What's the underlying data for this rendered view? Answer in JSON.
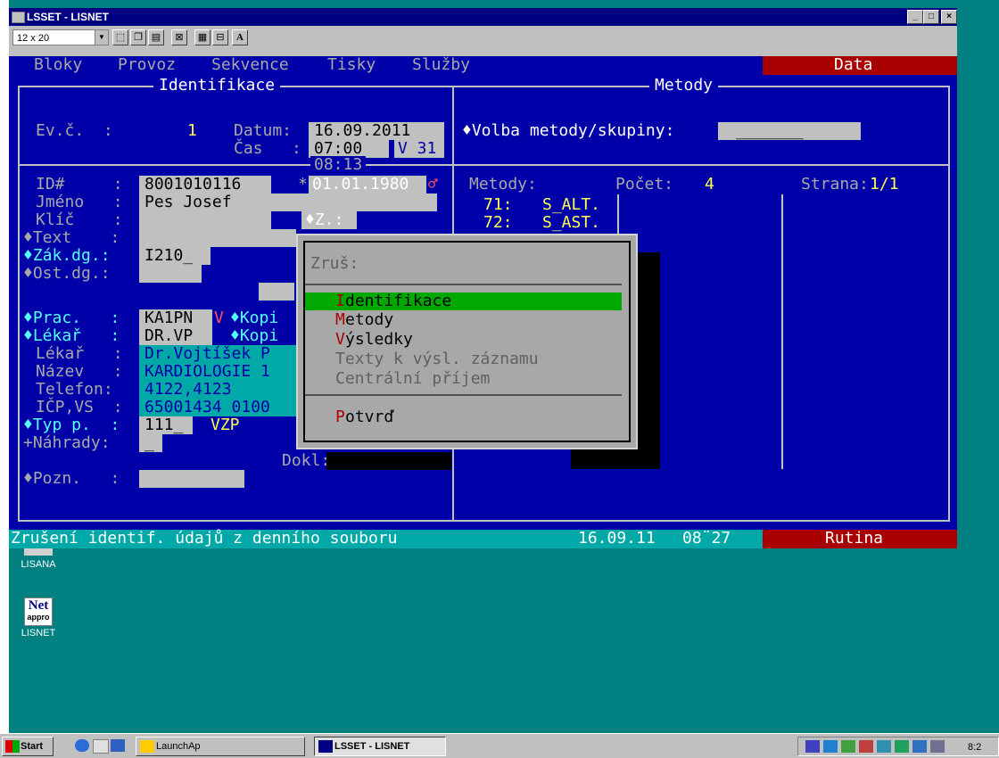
{
  "window": {
    "title": "LSSET - LISNET",
    "min": "_",
    "max": "□",
    "close": "×"
  },
  "toolbar": {
    "font_size": "12 x 20",
    "font_button": "A"
  },
  "menu": {
    "items": [
      "Bloky",
      "Provoz",
      "Sekvence",
      "Tisky",
      "Služby"
    ],
    "mode": "Data"
  },
  "identifikace": {
    "title": "Identifikace",
    "evc_label": "Ev.č.  :",
    "evc_value": "1",
    "datum_label": "Datum:",
    "datum_value": "16.09.2011",
    "cas_label": "Čas   :",
    "cas_value": "07:00",
    "v_value": "V 31",
    "time_below": "08:13",
    "id_label": "ID#     :",
    "id_value": "8001010116",
    "birth_marker": "*",
    "birth_date": "01.01.1980",
    "sex": "♂",
    "jmeno_label": "Jméno   :",
    "jmeno_value": "Pes Josef",
    "klic_label": "Klíč    :",
    "z_label": "♦Z.:",
    "text_label": "♦Text    :",
    "zakdg_label": "♦Zák.dg.:",
    "zakdg_value": "I210_",
    "ostdg_label": "♦Ost.dg.:",
    "prac_label": "♦Prac.   :",
    "prac_value": "KA1PN",
    "prac_flag": "V",
    "kopie1": "♦Kopi",
    "lekar1_label": "♦Lékař   :",
    "lekar1_value": "DR.VP",
    "kopie2": "♦Kopi",
    "lekar2_label": "Lékař   :",
    "lekar2_value": "Dr.Vojtíšek P",
    "nazev_label": "Název   :",
    "nazev_value": "KARDIOLOGIE 1",
    "telefon_label": "Telefon:",
    "telefon_value": "4122,4123",
    "icp_label": "IČP,VS  :",
    "icp_value": "65001434 0100",
    "typp_label": "♦Typ p.  :",
    "typp_value": "111_",
    "typp_ins": "VZP",
    "nahrady_label": "+Náhrady:",
    "nahrady_value": "_",
    "dokl_label": "Dokl:",
    "pozn_label": "♦Pozn.   :"
  },
  "metody": {
    "title": "Metody",
    "volba_label": "♦Volba metody/skupiny:",
    "metody_label": "Metody:",
    "pocet_label": "Počet:",
    "pocet_value": "4",
    "strana_label": "Strana:",
    "strana_value": "1/1",
    "items": [
      {
        "num": "71:",
        "code": "S_ALT."
      },
      {
        "num": "72:",
        "code": "S_AST."
      }
    ]
  },
  "popup": {
    "title": "Zruš:",
    "items": [
      {
        "hot": "I",
        "rest": "dentifikace",
        "state": "selected"
      },
      {
        "hot": "M",
        "rest": "etody",
        "state": "enabled"
      },
      {
        "hot": "V",
        "rest": "ýsledky",
        "state": "enabled"
      },
      {
        "hot": "",
        "rest": "Texty k výsl. záznamu",
        "state": "disabled"
      },
      {
        "hot": "",
        "rest": "Centrální příjem",
        "state": "disabled"
      }
    ],
    "confirm_hot": "P",
    "confirm_rest": "otvrď"
  },
  "status": {
    "message": "Zrušení identif. údajů z denního souboru",
    "date": "16.09.11",
    "time": "08¨27",
    "mode": "Rutina"
  },
  "desktop": {
    "icon1_label": "LISANA",
    "icon2_label": "LISNET",
    "icon2_text": "Net",
    "icon2_sub": "appro"
  },
  "taskbar": {
    "start": "Start",
    "launch": "LaunchAp",
    "active_task": "LSSET - LISNET",
    "clock": "8:2"
  },
  "colors": {
    "console_bg": "#0000a8",
    "menu_active": "#a80000",
    "highlight": "#00a800",
    "status_bg": "#00a8a8"
  }
}
